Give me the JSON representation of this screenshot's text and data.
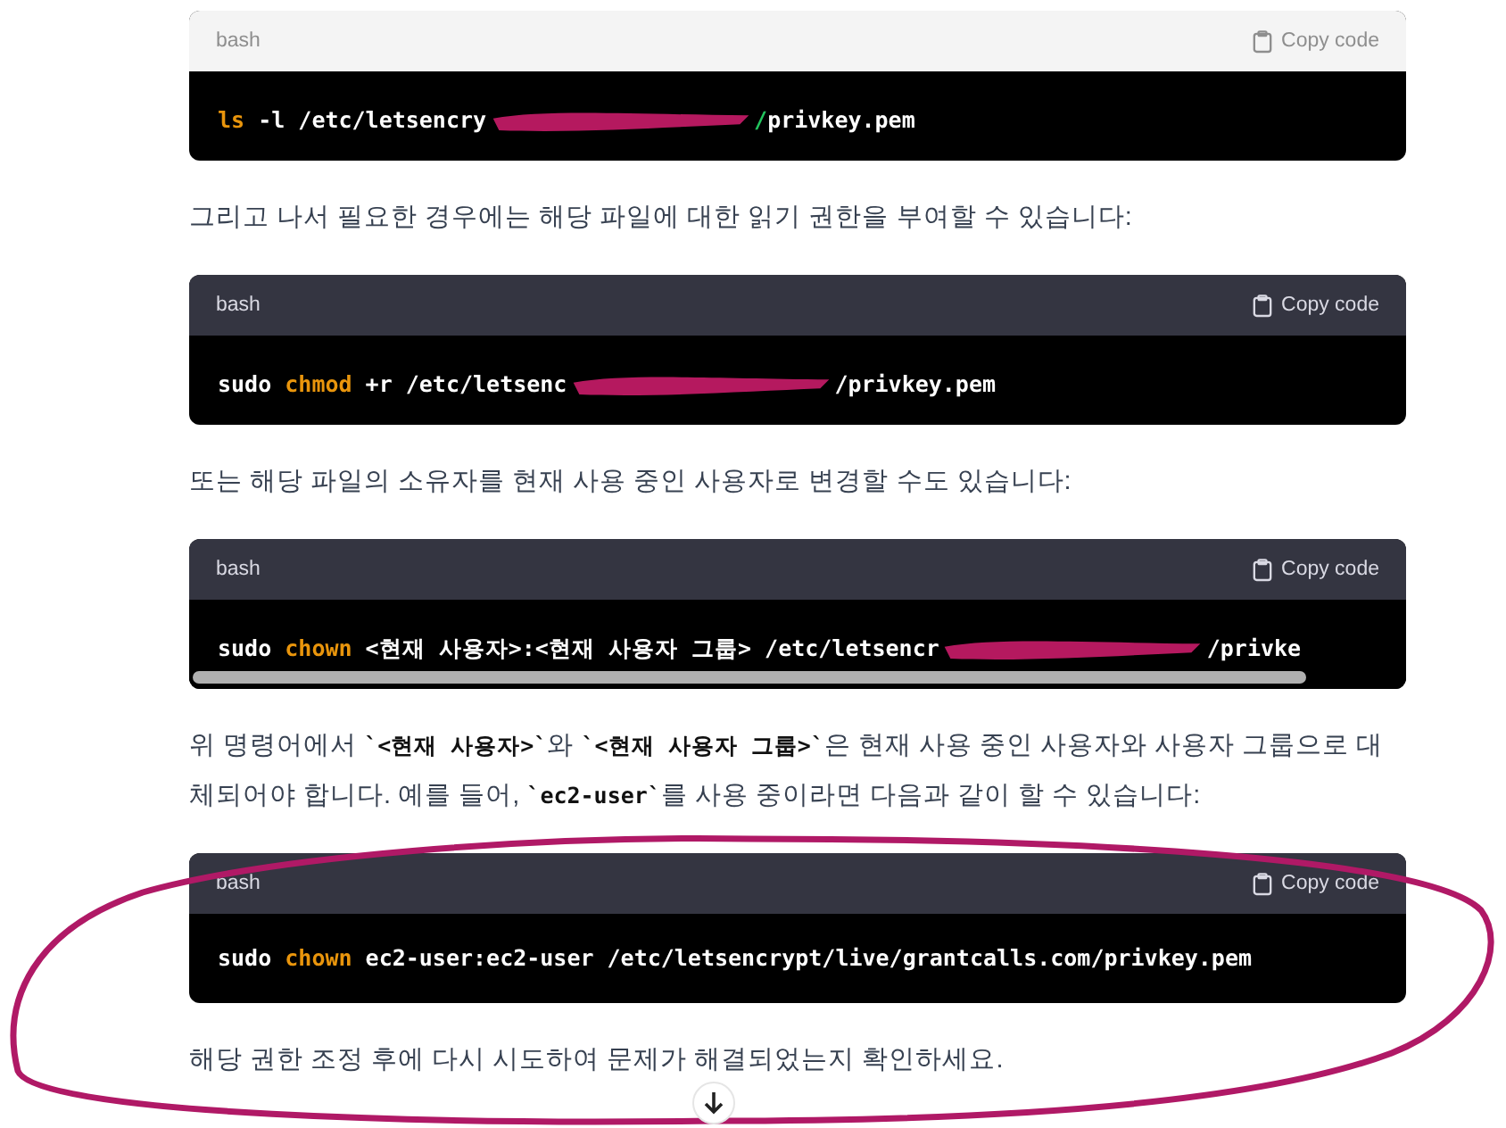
{
  "blocks": [
    {
      "kind": "code",
      "language": "bash",
      "copy_label": "Copy code",
      "faded_header": true,
      "scrollable": false,
      "tokens": [
        {
          "kind": "cmd",
          "text": "ls"
        },
        {
          "kind": "plain",
          "text": " -l /etc/letsencry"
        },
        {
          "kind": "redaction"
        },
        {
          "kind": "path",
          "text": "/"
        },
        {
          "kind": "plain",
          "text": "privkey.pem"
        }
      ]
    },
    {
      "kind": "paragraph",
      "parts": [
        {
          "kind": "text",
          "text": "그리고 나서 필요한 경우에는 해당 파일에 대한 읽기 권한을 부여할 수 있습니다:"
        }
      ]
    },
    {
      "kind": "code",
      "language": "bash",
      "copy_label": "Copy code",
      "faded_header": false,
      "scrollable": false,
      "tokens": [
        {
          "kind": "plain",
          "text": "sudo "
        },
        {
          "kind": "cmd",
          "text": "chmod"
        },
        {
          "kind": "plain",
          "text": " +r /etc/letsenc"
        },
        {
          "kind": "redaction"
        },
        {
          "kind": "plain",
          "text": "/privkey.pem"
        }
      ]
    },
    {
      "kind": "paragraph",
      "parts": [
        {
          "kind": "text",
          "text": "또는 해당 파일의 소유자를 현재 사용 중인 사용자로 변경할 수도 있습니다:"
        }
      ]
    },
    {
      "kind": "code",
      "language": "bash",
      "copy_label": "Copy code",
      "faded_header": false,
      "scrollable": true,
      "tokens": [
        {
          "kind": "plain",
          "text": "sudo "
        },
        {
          "kind": "cmd",
          "text": "chown"
        },
        {
          "kind": "plain",
          "text": " <현재 사용자>:<현재 사용자 그룹> /etc/letsencr"
        },
        {
          "kind": "redaction"
        },
        {
          "kind": "plain",
          "text": "/privke"
        }
      ]
    },
    {
      "kind": "paragraph",
      "parts": [
        {
          "kind": "text",
          "text": "위 명령어에서 "
        },
        {
          "kind": "code",
          "text": "`<현재 사용자>`"
        },
        {
          "kind": "text",
          "text": "와 "
        },
        {
          "kind": "code",
          "text": "`<현재 사용자 그룹>`"
        },
        {
          "kind": "text",
          "text": "은 현재 사용 중인 사용자와 사용자 그룹으로 대체되어야 합니다. 예를 들어, "
        },
        {
          "kind": "code",
          "text": "`ec2-user`"
        },
        {
          "kind": "text",
          "text": "를 사용 중이라면 다음과 같이 할 수 있습니다:"
        }
      ]
    },
    {
      "kind": "code",
      "language": "bash",
      "copy_label": "Copy code",
      "faded_header": false,
      "scrollable": false,
      "tokens": [
        {
          "kind": "plain",
          "text": "sudo "
        },
        {
          "kind": "cmd",
          "text": "chown"
        },
        {
          "kind": "plain",
          "text": " ec2-user:ec2-user /etc/letsencrypt/live/grantcalls.com/privkey.pem"
        }
      ]
    },
    {
      "kind": "paragraph",
      "parts": [
        {
          "kind": "text",
          "text": "해당 권한 조정 후에 다시 시도하여 문제가 해결되었는지 확인하세요."
        }
      ]
    }
  ],
  "annotation_ellipse": true,
  "scroll_down_button": true
}
